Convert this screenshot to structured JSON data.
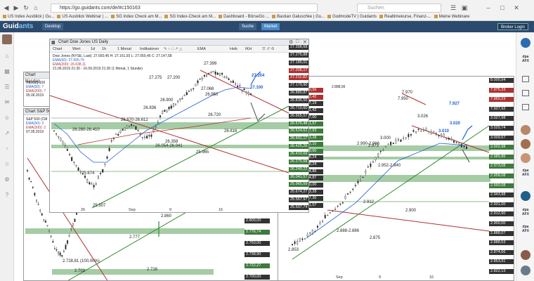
{
  "browser": {
    "url": "https://go.guidants.com/de/#c150163",
    "search_placeholder": "Suchen",
    "bookmarks": [
      "US Index Ausblick | Gu...",
      "US Ausblick Webinar | ...",
      "SG Index Check am M...",
      "SG Index-Check am M...",
      "Dashboard - BörseGo ...",
      "Bastian Galuschke | Gu...",
      "GodmodeTV | Guidants",
      "Realtimekurse, Finanz-...",
      "Meine Webinare"
    ]
  },
  "app": {
    "logo_main": "Guid",
    "logo_accent": "ants",
    "desktop_label": "Desktop",
    "search_label": "Suche",
    "market_label": "Market",
    "login_label": "Broker Login"
  },
  "colors": {
    "header": "#2b4a6d",
    "resistance": "#b03030",
    "support": "#2e8b2e",
    "zone": "#8fbf8f",
    "price_tag": "#333333",
    "accent_blue": "#1f5fd1"
  },
  "dow": {
    "title": "Chart Dow Jones US Daily",
    "toolbar": [
      "Chart",
      "Wert",
      "1d",
      "1h",
      "1 Monat",
      "Indikatoren",
      "EMA",
      "Heik",
      "IKH"
    ],
    "legend": [
      "Dow Jones (NYSE, Last): 27.650,45 H: 27.161,93 L: 27.050,45 C: 27.147,58",
      "EMA(50): 27.005,79",
      "EMA(200): 26.638,11",
      "21.06.2019 21:30 - 16.09.2019 21:30 (1 Monat, 1 Stunde)"
    ],
    "levels": [
      "27.399",
      "27.275",
      "27.200",
      "27.204",
      "27.100",
      "27.068",
      "26.950",
      "26.900",
      "26.836",
      "26.720",
      "26.670-26.612",
      "26.616",
      "26.280-26.410",
      "26.358",
      "26.054-26.041",
      "25.965",
      "25.507",
      "25.674"
    ],
    "price_axis": [
      "27.398,68",
      "27.275,88",
      "27.185,01",
      "27.206,17",
      "27.211,82",
      "27.179,90",
      "26.880,87",
      "26.836,50",
      "26.710,60",
      "26.665,57",
      "26.576,48",
      "26.514,62",
      "26.491,17",
      "26.425,26",
      "26.410,69",
      "26.275,68",
      "26.249,22",
      "26.041,57",
      "25.965,59",
      "25.674,27",
      "25.567,97",
      "25.507,74"
    ],
    "time_axis": [
      "26",
      "Sep",
      "9",
      "16"
    ]
  },
  "nasdaq_strip": {
    "title": "Chart Nasdaq",
    "legend": [
      "Nasdaq-100",
      "EMA(50): 7",
      "EMA(200): 7",
      "05.06.2019"
    ]
  },
  "sp_strip": {
    "title": "Chart S&P 500",
    "legend": [
      "S&P 500 (CM",
      "EMA(50): 2",
      "EMA(200): 2",
      "07.05.2019"
    ],
    "levels": [
      "2.892,93",
      "2.860",
      "2.840",
      "2.777",
      "2.728,81 (100,00%)",
      "2.702",
      "2.728"
    ],
    "price_axis": [
      "2.825,00",
      "2.800,00",
      "2.776,74",
      "2.750,00",
      "2.738,90",
      "2.722,27",
      "2.700,00"
    ]
  },
  "sp_main": {
    "levels": [
      "7.970",
      "7.950",
      "7.927",
      "3.026",
      "3.020",
      "3.010",
      "3.000",
      "2.990-2.986",
      "2.973",
      "2.952-2.940",
      "2.958",
      "2.943",
      "2.931",
      "2.912",
      "2.900",
      "2.888-2.886",
      "2.875",
      "2.853",
      "2.888,56"
    ],
    "price_axis": [
      "8.000,94",
      "7.975,33",
      "7.950,23",
      "7.927,92",
      "3.027,98",
      "3.020,74",
      "3.009,57",
      "3.002,98",
      "2.985,86",
      "2.973,08",
      "2.958,08",
      "2.950,08",
      "2.943,98",
      "2.931,00",
      "2.912,90",
      "2.900,00",
      "2.888,07",
      "2.888,53",
      "2.874,66",
      "2.853,91",
      "2.822,13"
    ],
    "mid_axis": [
      "26.890,56",
      "26.902,42",
      "26.397,19",
      "26.241,42",
      "26.107,00",
      "26.041,57",
      "25.957,63",
      "25.523,28",
      "25.382,10",
      "25.298,60",
      "25.008,24",
      "24.958,24",
      "24.874,86",
      "24.674,87",
      "24.400,00",
      "25.523,28",
      "25.447,30",
      "25.441,57"
    ],
    "time_axis": [
      "Sep",
      "9",
      "16"
    ]
  }
}
